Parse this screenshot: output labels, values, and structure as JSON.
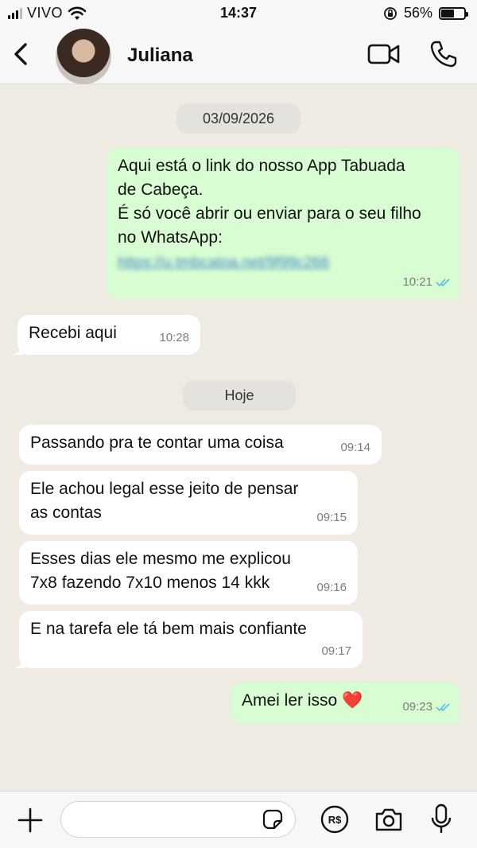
{
  "status_bar": {
    "carrier": "VIVO",
    "time": "14:37",
    "battery_percent": "56%",
    "battery_level": 0.56,
    "icons": [
      "signal-icon",
      "wifi-icon",
      "orientation-lock-icon",
      "battery-icon"
    ]
  },
  "header": {
    "contact_name": "Juliana",
    "icons": [
      "back-chevron-icon",
      "video-call-icon",
      "phone-icon"
    ]
  },
  "chat": {
    "dates": [
      {
        "label": "03/09/2026"
      },
      {
        "label": "Hoje"
      }
    ],
    "messages": [
      {
        "direction": "out",
        "text": "Aqui está o link do nosso App Tabuada\nde Cabeça.\nÉ só você abrir ou enviar para o seu filho\nno WhatsApp:",
        "link": "https://u.tmbcatoa.net/9f99c266",
        "time": "10:21",
        "status": "read"
      },
      {
        "direction": "in",
        "text": "Recebi aqui",
        "time": "10:28"
      },
      {
        "direction": "in",
        "text": "Passando pra te contar uma coisa",
        "time": "09:14"
      },
      {
        "direction": "in",
        "text": "Ele achou legal esse jeito de pensar\nas contas",
        "time": "09:15"
      },
      {
        "direction": "in",
        "text": "Esses dias ele mesmo me explicou\n7x8 fazendo 7x10 menos 14 kkk",
        "time": "09:16"
      },
      {
        "direction": "in",
        "text": "E na tarefa ele tá bem mais confiante",
        "time": "09:17"
      },
      {
        "direction": "out",
        "text": "Amei ler isso ❤️",
        "time": "09:23",
        "status": "read"
      }
    ]
  },
  "input_bar": {
    "placeholder": "",
    "value": "",
    "icons": [
      "plus-icon",
      "sticker-icon",
      "pix-payment-icon",
      "camera-icon",
      "microphone-icon"
    ]
  },
  "colors": {
    "chat_background": "#efeae2",
    "incoming_bubble": "#ffffff",
    "outgoing_bubble": "#d9fdd3",
    "read_ticks": "#53bdeb",
    "bars": "#f7f7f7"
  }
}
